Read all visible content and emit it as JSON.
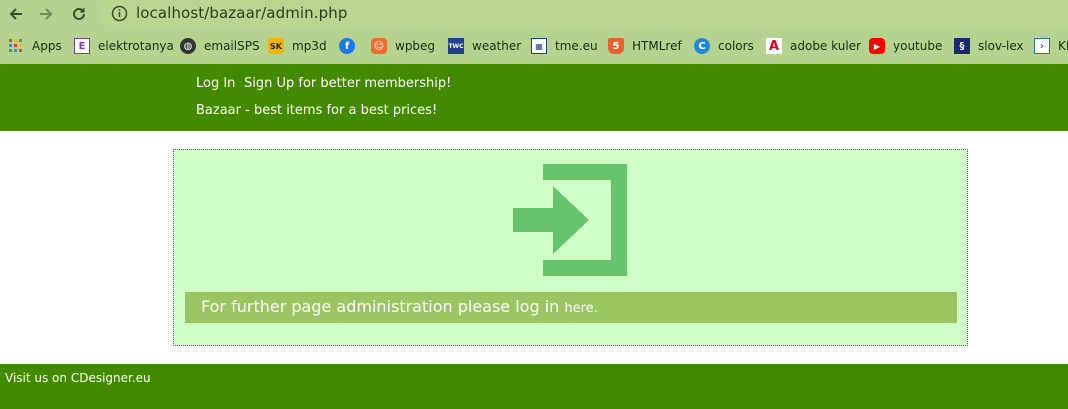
{
  "browser": {
    "url": "localhost/bazaar/admin.php"
  },
  "bookmarks": [
    {
      "label": "Apps",
      "icon": "apps-grid-icon"
    },
    {
      "label": "elektrotanya",
      "icon": "elektrotanya-icon"
    },
    {
      "label": "emailSPS",
      "icon": "globe-icon"
    },
    {
      "label": "mp3d",
      "icon": "mp3d-icon"
    },
    {
      "label": "",
      "icon": "facebook-icon"
    },
    {
      "label": "wpbeg",
      "icon": "wpbeg-icon"
    },
    {
      "label": "weather",
      "icon": "weather-channel-icon"
    },
    {
      "label": "tme.eu",
      "icon": "tme-icon"
    },
    {
      "label": "HTMLref",
      "icon": "html5-icon"
    },
    {
      "label": "colors",
      "icon": "colors-icon"
    },
    {
      "label": "adobe kuler",
      "icon": "adobe-icon"
    },
    {
      "label": "youtube",
      "icon": "youtube-icon"
    },
    {
      "label": "slov-lex",
      "icon": "slov-lex-icon"
    },
    {
      "label": "KE",
      "icon": "ke-icon"
    }
  ],
  "header": {
    "login_label": "Log In",
    "signup_label": "Sign Up for better membership!",
    "tagline": "Bazaar - best items for a best prices!"
  },
  "panel": {
    "message": "For further page administration please log in ",
    "link_label": "here."
  },
  "footer": {
    "text": "Visit us on CDesigner.eu"
  },
  "colors": {
    "header_green": "#438a00",
    "panel_bg": "#d0fcc8",
    "message_bar": "#9bc463",
    "icon_green": "#66c46d",
    "browser_chrome": "#b4d38e"
  }
}
